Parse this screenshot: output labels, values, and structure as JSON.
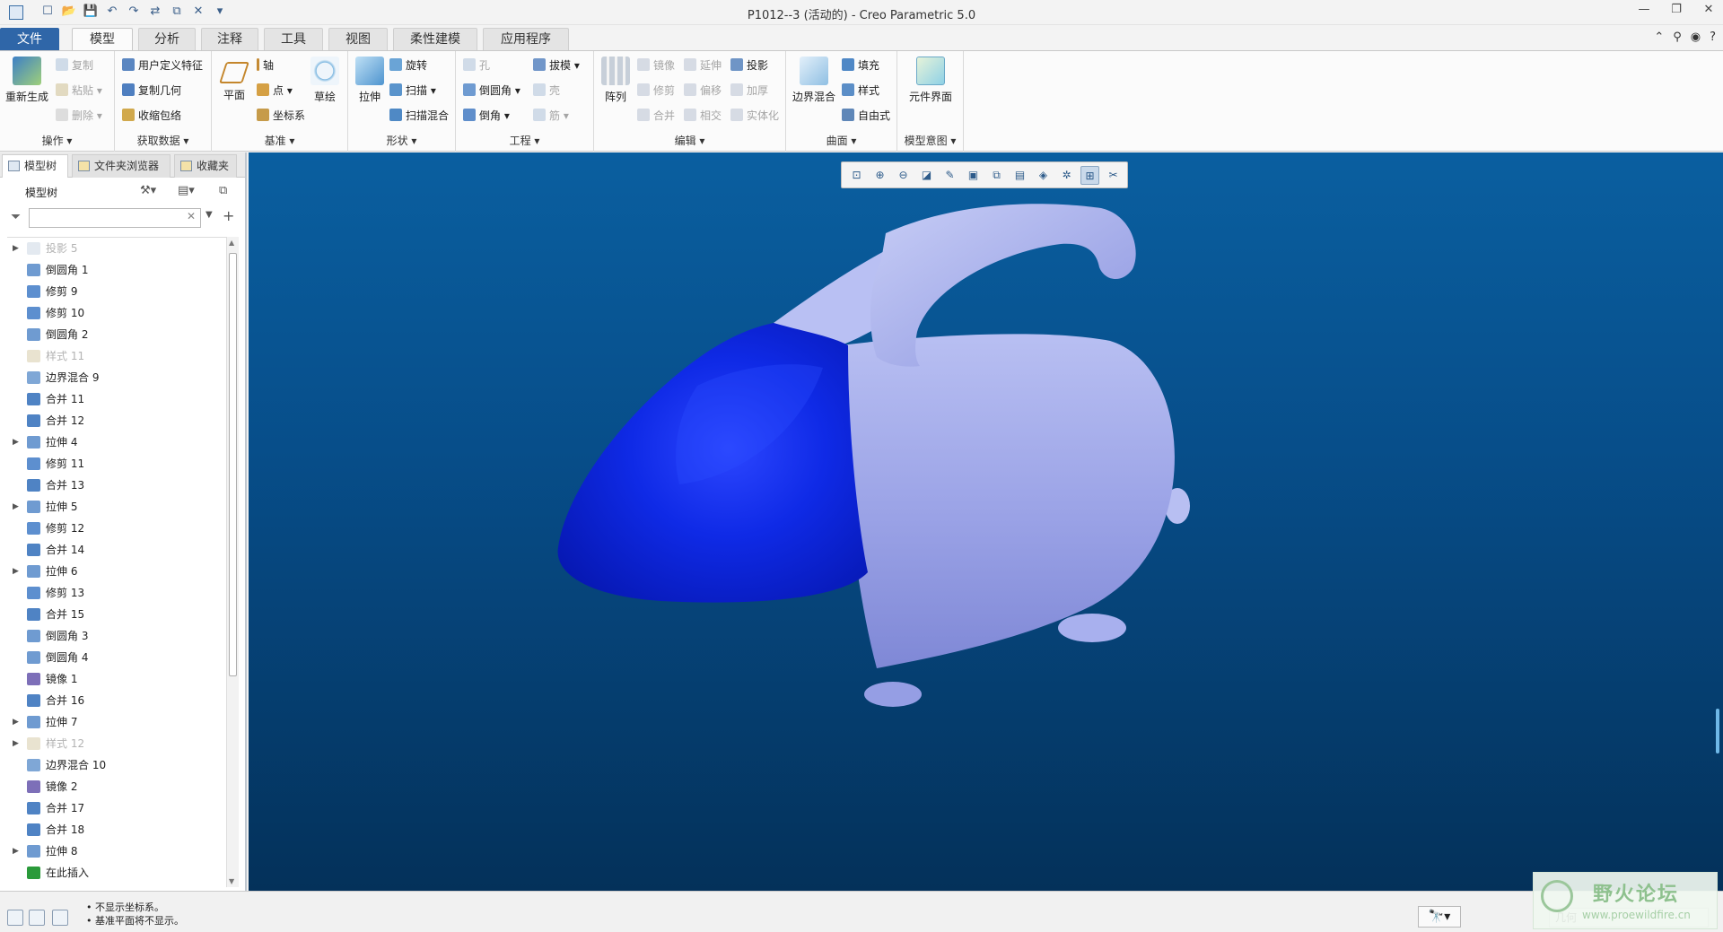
{
  "window": {
    "title": "P1012--3 (活动的) - Creo Parametric 5.0",
    "controls": [
      "—",
      "❐",
      "✕"
    ]
  },
  "quick_access": [
    "☐",
    "📂",
    "💾",
    "↶",
    "↷",
    "⇄",
    "⧉",
    "✕",
    "▾"
  ],
  "menu_tabs": [
    "文件",
    "模型",
    "分析",
    "注释",
    "工具",
    "视图",
    "柔性建模",
    "应用程序"
  ],
  "menu_active": "模型",
  "ribbon": {
    "groups": [
      {
        "name": "操作 ▾"
      },
      {
        "name": "获取数据 ▾"
      },
      {
        "name": "基准 ▾"
      },
      {
        "name": "形状 ▾"
      },
      {
        "name": "工程 ▾"
      },
      {
        "name": "编辑 ▾"
      },
      {
        "name": "曲面 ▾"
      },
      {
        "name": "模型意图 ▾"
      }
    ],
    "regenerate": "重新生成",
    "copy": "复制",
    "paste": "粘贴 ▾",
    "delete": "删除 ▾",
    "udf": "用户定义特征",
    "copy_geom": "复制几何",
    "shrinkwrap": "收缩包络",
    "plane": "平面",
    "axis": "轴",
    "point": "点 ▾",
    "csys": "坐标系",
    "sketch": "草绘",
    "extrude": "拉伸",
    "revolve": "旋转",
    "sweep": "扫描 ▾",
    "swept_blend": "扫描混合",
    "hole": "孔",
    "round": "倒圆角 ▾",
    "chamfer": "倒角 ▾",
    "draft": "拔模 ▾",
    "shell": "壳",
    "rib": "筋 ▾",
    "pattern": "阵列",
    "mirror": "镜像",
    "trim": "修剪",
    "merge": "合并",
    "extend": "延伸",
    "offset": "偏移",
    "intersect": "相交",
    "project": "投影",
    "thicken": "加厚",
    "solidify": "实体化",
    "boundary_blend": "边界混合",
    "fill": "填充",
    "style": "样式",
    "freestyle": "自由式",
    "component_interface": "元件界面"
  },
  "panel_tabs": [
    "模型树",
    "文件夹浏览器",
    "收藏夹"
  ],
  "tree_header": "模型树",
  "filter_placeholder": "",
  "tree_items": [
    {
      "label": "投影 5",
      "expand": true,
      "dim": true,
      "color": "#b9c7d9"
    },
    {
      "label": "倒圆角 1",
      "expand": false,
      "dim": false,
      "color": "#6f9bd1"
    },
    {
      "label": "修剪 9",
      "expand": false,
      "dim": false,
      "color": "#5d8fcf"
    },
    {
      "label": "修剪 10",
      "expand": false,
      "dim": false,
      "color": "#5d8fcf"
    },
    {
      "label": "倒圆角 2",
      "expand": false,
      "dim": false,
      "color": "#6f9bd1"
    },
    {
      "label": "样式 11",
      "expand": false,
      "dim": true,
      "color": "#c8b98a"
    },
    {
      "label": "边界混合 9",
      "expand": false,
      "dim": false,
      "color": "#7fa7d6"
    },
    {
      "label": "合并 11",
      "expand": false,
      "dim": false,
      "color": "#4f83c4"
    },
    {
      "label": "合并 12",
      "expand": false,
      "dim": false,
      "color": "#4f83c4"
    },
    {
      "label": "拉伸 4",
      "expand": true,
      "dim": false,
      "color": "#6f9bd1"
    },
    {
      "label": "修剪 11",
      "expand": false,
      "dim": false,
      "color": "#5d8fcf"
    },
    {
      "label": "合并 13",
      "expand": false,
      "dim": false,
      "color": "#4f83c4"
    },
    {
      "label": "拉伸 5",
      "expand": true,
      "dim": false,
      "color": "#6f9bd1"
    },
    {
      "label": "修剪 12",
      "expand": false,
      "dim": false,
      "color": "#5d8fcf"
    },
    {
      "label": "合并 14",
      "expand": false,
      "dim": false,
      "color": "#4f83c4"
    },
    {
      "label": "拉伸 6",
      "expand": true,
      "dim": false,
      "color": "#6f9bd1"
    },
    {
      "label": "修剪 13",
      "expand": false,
      "dim": false,
      "color": "#5d8fcf"
    },
    {
      "label": "合并 15",
      "expand": false,
      "dim": false,
      "color": "#4f83c4"
    },
    {
      "label": "倒圆角 3",
      "expand": false,
      "dim": false,
      "color": "#6f9bd1"
    },
    {
      "label": "倒圆角 4",
      "expand": false,
      "dim": false,
      "color": "#6f9bd1"
    },
    {
      "label": "镜像 1",
      "expand": false,
      "dim": false,
      "color": "#7d6fb8"
    },
    {
      "label": "合并 16",
      "expand": false,
      "dim": false,
      "color": "#4f83c4"
    },
    {
      "label": "拉伸 7",
      "expand": true,
      "dim": false,
      "color": "#6f9bd1"
    },
    {
      "label": "样式 12",
      "expand": true,
      "dim": true,
      "color": "#c8b98a"
    },
    {
      "label": "边界混合 10",
      "expand": false,
      "dim": false,
      "color": "#7fa7d6"
    },
    {
      "label": "镜像 2",
      "expand": false,
      "dim": false,
      "color": "#7d6fb8"
    },
    {
      "label": "合并 17",
      "expand": false,
      "dim": false,
      "color": "#4f83c4"
    },
    {
      "label": "合并 18",
      "expand": false,
      "dim": false,
      "color": "#4f83c4"
    },
    {
      "label": "拉伸 8",
      "expand": true,
      "dim": false,
      "color": "#6f9bd1"
    },
    {
      "label": "在此插入",
      "expand": false,
      "dim": false,
      "color": "#2a9a3a"
    }
  ],
  "view_toolbar": [
    "⊡",
    "⊕",
    "⊖",
    "◪",
    "✎",
    "▣",
    "⧉",
    "▤",
    "◈",
    "✲",
    "⊞",
    "✂"
  ],
  "status": {
    "messages": [
      "• 不显示坐标系。",
      "• 基准平面将不显示。"
    ],
    "selection_filter": "几何",
    "binoculars": "🔭▾"
  },
  "watermark": {
    "title": "野火论坛",
    "url": "www.proewildfire.cn"
  },
  "colors": {
    "file_tab": "#2f66a8",
    "viewport_top": "#0a5fa0",
    "viewport_bottom": "#04315a",
    "body_front": "#0a1fd8",
    "body_rear": "#9aa2e6"
  }
}
